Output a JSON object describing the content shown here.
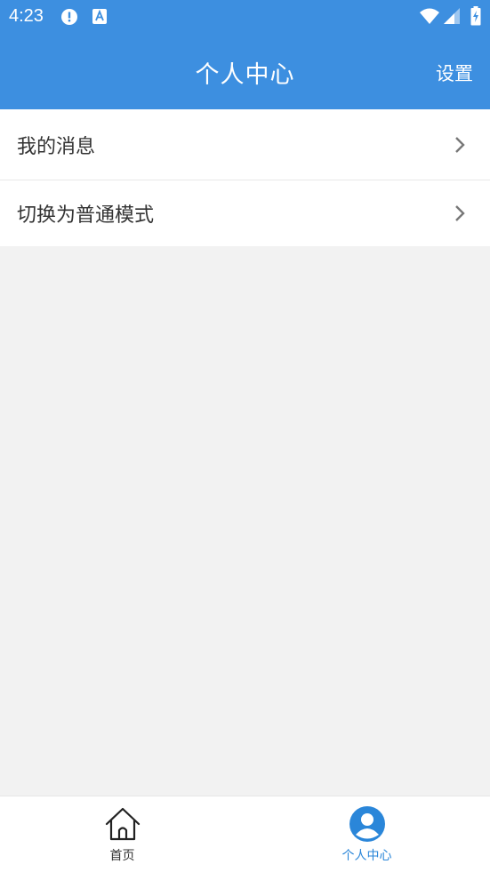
{
  "status_bar": {
    "time": "4:23",
    "icons": [
      "alert-icon",
      "a-icon",
      "wifi-icon",
      "signal-icon",
      "battery-icon"
    ]
  },
  "app_bar": {
    "title": "个人中心",
    "settings_label": "设置",
    "color": "#3d8fe0"
  },
  "menu": {
    "items": [
      {
        "label": "我的消息",
        "icon": "chevron-right-icon"
      },
      {
        "label": "切换为普通模式",
        "icon": "chevron-right-icon"
      }
    ]
  },
  "bottom_nav": {
    "items": [
      {
        "label": "首页",
        "icon": "home-icon",
        "active": false
      },
      {
        "label": "个人中心",
        "icon": "user-icon",
        "active": true
      }
    ],
    "active_color": "#2a86d9"
  }
}
